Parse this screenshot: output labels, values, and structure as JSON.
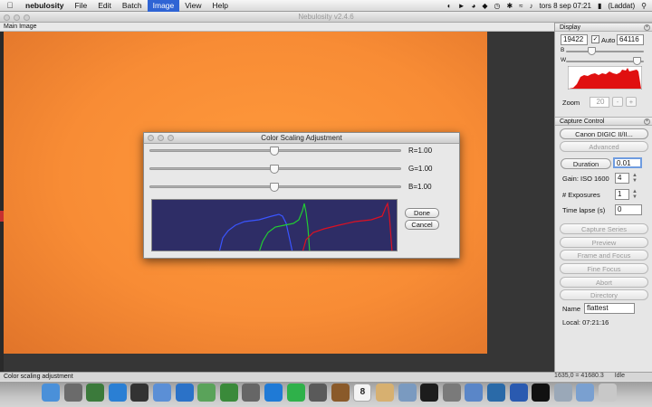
{
  "menubar": {
    "app_name": "nebulosity",
    "items": [
      "File",
      "Edit",
      "Batch",
      "Image",
      "View",
      "Help"
    ],
    "active_item": "Image",
    "clock": "tors 8 sep  07:21",
    "battery": "(Laddat)"
  },
  "window": {
    "title": "Nebulosity v2.4.6"
  },
  "main_panel": {
    "label": "Main Image",
    "status_text": "Color scaling adjustment",
    "coords": "1635,0 = 41680.3",
    "status_right": "Idle"
  },
  "display": {
    "header": "Display",
    "black_value": "19422",
    "white_value": "64116",
    "auto_label": "Auto",
    "b_label": "B",
    "w_label": "W",
    "zoom_label": "Zoom",
    "zoom_value": "20",
    "zoom_minus": "-",
    "zoom_plus": "+"
  },
  "capture": {
    "header": "Capture Control",
    "camera": "Canon DIGIC II/II...",
    "advanced": "Advanced",
    "duration_select": "Duration",
    "duration_value": "0.01",
    "gain_label": "Gain: ISO 1600",
    "gain_value": "4",
    "exposures_label": "# Exposures",
    "exposures_value": "1",
    "timelapse_label": "Time lapse (s)",
    "timelapse_value": "0",
    "buttons": [
      "Capture Series",
      "Preview",
      "Frame and Focus",
      "Fine Focus",
      "Abort",
      "Directory"
    ],
    "name_label": "Name",
    "name_value": "flattest",
    "local_time": "Local: 07:21:16"
  },
  "dialog": {
    "title": "Color Scaling Adjustment",
    "r_label": "R=1.00",
    "g_label": "G=1.00",
    "b_label": "B=1.00",
    "r_value": 1.0,
    "g_value": 1.0,
    "b_value": 1.0,
    "done": "Done",
    "cancel": "Cancel"
  },
  "colors": {
    "image_orange": "#f88c35",
    "histogram_bg": "#2e2d66",
    "menu_highlight": "#2f64d4"
  },
  "dock": {
    "icons": [
      "finder-icon",
      "app-icon",
      "photo-icon",
      "safari-icon",
      "clock-icon",
      "mail-icon",
      "compass-icon",
      "android-icon",
      "facetime-icon",
      "camera-icon",
      "itunes-icon",
      "spotify-icon",
      "iphoto-icon",
      "movie-icon",
      "calendar-icon",
      "notes-icon",
      "preview-icon",
      "terminal-icon",
      "tool-icon",
      "imac-icon",
      "network-icon",
      "photoshop-icon",
      "nebula-icon",
      "downloads-icon",
      "folder-icon",
      "trash-icon"
    ],
    "calendar_day": "8"
  }
}
